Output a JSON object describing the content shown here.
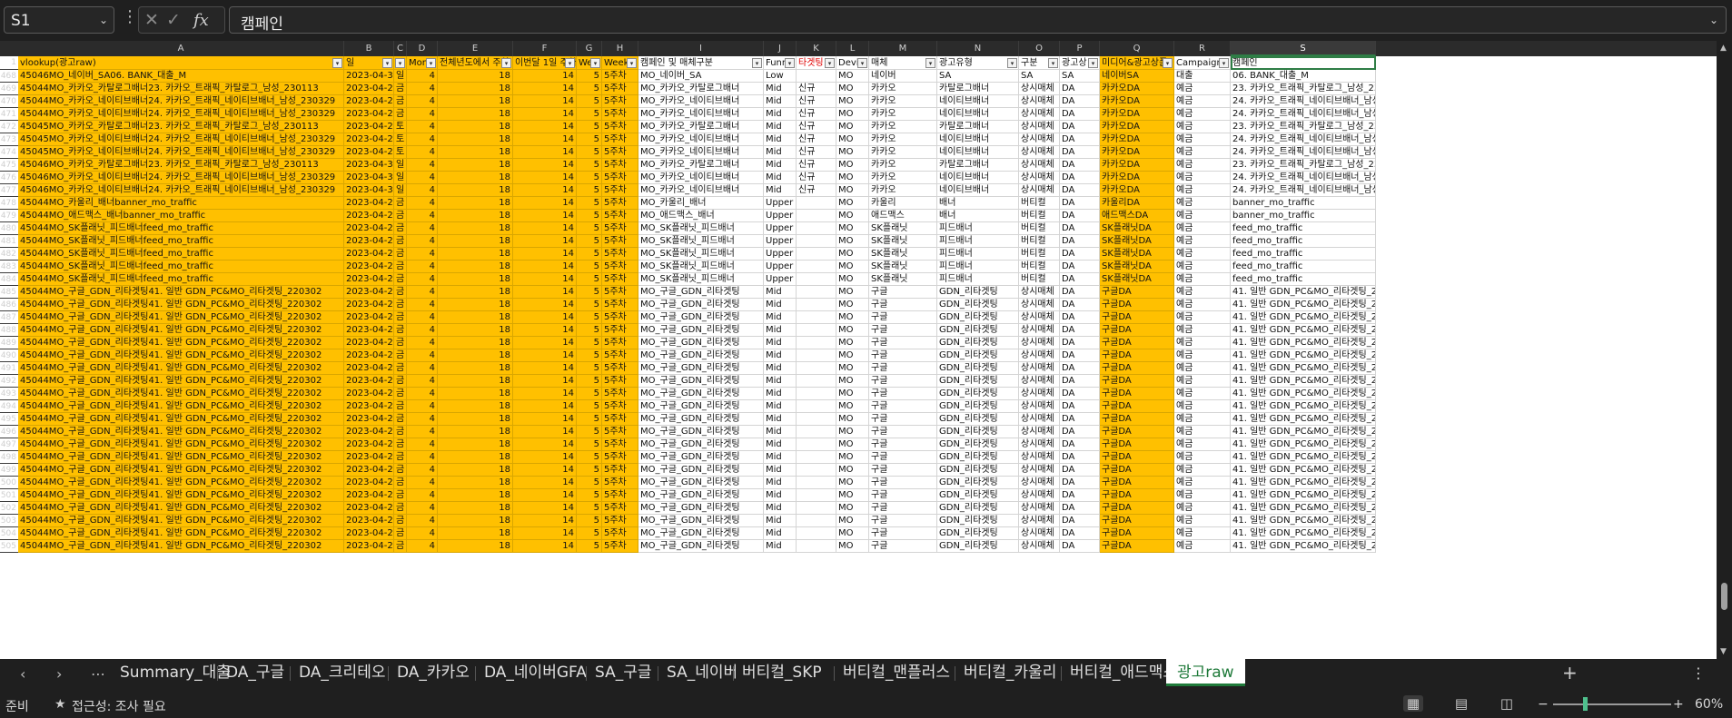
{
  "formula_bar": {
    "name_box": "S1",
    "formula": "캠페인",
    "cancel_icon": "x-icon",
    "enter_icon": "check-icon",
    "fx_label": "fx"
  },
  "columns": [
    "A",
    "B",
    "C",
    "D",
    "E",
    "F",
    "G",
    "H",
    "I",
    "J",
    "K",
    "L",
    "M",
    "N",
    "O",
    "P",
    "Q",
    "R",
    "S"
  ],
  "active_column": "S",
  "header_row": {
    "number": "1",
    "labels": [
      "vlookup(광고raw)",
      "일",
      "요",
      "Mon",
      "전체년도에서 주차",
      "이번달 1일 주차",
      "We",
      "Week",
      "캠페인 및 매체구분",
      "Funn",
      "타겟팅",
      "Devi",
      "매체",
      "광고유형",
      "구분",
      "광고상",
      "미디어&광고상품",
      "Campaign",
      "캠페인"
    ]
  },
  "rows": [
    {
      "n": "468",
      "c": [
        "45046MO_네이버_SA06. BANK_대출_M",
        "2023-04-30",
        "일",
        "4",
        "18",
        "14",
        "5",
        "5주차",
        "MO_네이버_SA",
        "Low",
        "",
        "MO",
        "네이버",
        "SA",
        "SA",
        "SA",
        "네이버SA",
        "대출",
        "06. BANK_대출_M"
      ]
    },
    {
      "n": "469",
      "c": [
        "45044MO_카카오_카탈로그배너23. 카카오_트래픽_카탈로그_남성_230113",
        "2023-04-28",
        "금",
        "4",
        "18",
        "14",
        "5",
        "5주차",
        "MO_카카오_카탈로그배너",
        "Mid",
        "신규",
        "MO",
        "카카오",
        "카탈로그배너",
        "상시매체",
        "DA",
        "카카오DA",
        "예금",
        "23. 카카오_트래픽_카탈로그_남성_2301"
      ]
    },
    {
      "n": "470",
      "c": [
        "45044MO_카카오_네이티브배너24. 카카오_트래픽_네이티브배너_남성_230329",
        "2023-04-28",
        "금",
        "4",
        "18",
        "14",
        "5",
        "5주차",
        "MO_카카오_네이티브배너",
        "Mid",
        "신규",
        "MO",
        "카카오",
        "네이티브배너",
        "상시매체",
        "DA",
        "카카오DA",
        "예금",
        "24. 카카오_트래픽_네이티브배너_남성_2"
      ]
    },
    {
      "n": "471",
      "c": [
        "45044MO_카카오_네이티브배너24. 카카오_트래픽_네이티브배너_남성_230329",
        "2023-04-28",
        "금",
        "4",
        "18",
        "14",
        "5",
        "5주차",
        "MO_카카오_네이티브배너",
        "Mid",
        "신규",
        "MO",
        "카카오",
        "네이티브배너",
        "상시매체",
        "DA",
        "카카오DA",
        "예금",
        "24. 카카오_트래픽_네이티브배너_남성_2"
      ]
    },
    {
      "n": "472",
      "c": [
        "45045MO_카카오_카탈로그배너23. 카카오_트래픽_카탈로그_남성_230113",
        "2023-04-29",
        "토",
        "4",
        "18",
        "14",
        "5",
        "5주차",
        "MO_카카오_카탈로그배너",
        "Mid",
        "신규",
        "MO",
        "카카오",
        "카탈로그배너",
        "상시매체",
        "DA",
        "카카오DA",
        "예금",
        "23. 카카오_트래픽_카탈로그_남성_2301"
      ]
    },
    {
      "n": "473",
      "c": [
        "45045MO_카카오_네이티브배너24. 카카오_트래픽_네이티브배너_남성_230329",
        "2023-04-29",
        "토",
        "4",
        "18",
        "14",
        "5",
        "5주차",
        "MO_카카오_네이티브배너",
        "Mid",
        "신규",
        "MO",
        "카카오",
        "네이티브배너",
        "상시매체",
        "DA",
        "카카오DA",
        "예금",
        "24. 카카오_트래픽_네이티브배너_남성_2"
      ]
    },
    {
      "n": "474",
      "c": [
        "45045MO_카카오_네이티브배너24. 카카오_트래픽_네이티브배너_남성_230329",
        "2023-04-29",
        "토",
        "4",
        "18",
        "14",
        "5",
        "5주차",
        "MO_카카오_네이티브배너",
        "Mid",
        "신규",
        "MO",
        "카카오",
        "네이티브배너",
        "상시매체",
        "DA",
        "카카오DA",
        "예금",
        "24. 카카오_트래픽_네이티브배너_남성_2"
      ]
    },
    {
      "n": "475",
      "c": [
        "45046MO_카카오_카탈로그배너23. 카카오_트래픽_카탈로그_남성_230113",
        "2023-04-30",
        "일",
        "4",
        "18",
        "14",
        "5",
        "5주차",
        "MO_카카오_카탈로그배너",
        "Mid",
        "신규",
        "MO",
        "카카오",
        "카탈로그배너",
        "상시매체",
        "DA",
        "카카오DA",
        "예금",
        "23. 카카오_트래픽_카탈로그_남성_2301"
      ]
    },
    {
      "n": "476",
      "c": [
        "45046MO_카카오_네이티브배너24. 카카오_트래픽_네이티브배너_남성_230329",
        "2023-04-30",
        "일",
        "4",
        "18",
        "14",
        "5",
        "5주차",
        "MO_카카오_네이티브배너",
        "Mid",
        "신규",
        "MO",
        "카카오",
        "네이티브배너",
        "상시매체",
        "DA",
        "카카오DA",
        "예금",
        "24. 카카오_트래픽_네이티브배너_남성_2"
      ]
    },
    {
      "n": "477",
      "c": [
        "45046MO_카카오_네이티브배너24. 카카오_트래픽_네이티브배너_남성_230329",
        "2023-04-30",
        "일",
        "4",
        "18",
        "14",
        "5",
        "5주차",
        "MO_카카오_네이티브배너",
        "Mid",
        "신규",
        "MO",
        "카카오",
        "네이티브배너",
        "상시매체",
        "DA",
        "카카오DA",
        "예금",
        "24. 카카오_트래픽_네이티브배너_남성_2"
      ]
    },
    {
      "n": "478",
      "c": [
        "45044MO_카울리_배너banner_mo_traffic",
        "2023-04-28",
        "금",
        "4",
        "18",
        "14",
        "5",
        "5주차",
        "MO_카울리_배너",
        "Upper",
        "",
        "MO",
        "카울리",
        "배너",
        "버티컬",
        "DA",
        "카울리DA",
        "예금",
        "banner_mo_traffic"
      ]
    },
    {
      "n": "479",
      "c": [
        "45044MO_애드맥스_배너banner_mo_traffic",
        "2023-04-28",
        "금",
        "4",
        "18",
        "14",
        "5",
        "5주차",
        "MO_애드맥스_배너",
        "Upper",
        "",
        "MO",
        "애드맥스",
        "배너",
        "버티컬",
        "DA",
        "애드맥스DA",
        "예금",
        "banner_mo_traffic"
      ]
    },
    {
      "n": "480",
      "c": [
        "45044MO_SK플래닛_피드배너feed_mo_traffic",
        "2023-04-28",
        "금",
        "4",
        "18",
        "14",
        "5",
        "5주차",
        "MO_SK플래닛_피드배너",
        "Upper",
        "",
        "MO",
        "SK플래닛",
        "피드배너",
        "버티컬",
        "DA",
        "SK플래닛DA",
        "예금",
        "feed_mo_traffic"
      ]
    },
    {
      "n": "481",
      "c": [
        "45044MO_SK플래닛_피드배너feed_mo_traffic",
        "2023-04-28",
        "금",
        "4",
        "18",
        "14",
        "5",
        "5주차",
        "MO_SK플래닛_피드배너",
        "Upper",
        "",
        "MO",
        "SK플래닛",
        "피드배너",
        "버티컬",
        "DA",
        "SK플래닛DA",
        "예금",
        "feed_mo_traffic"
      ]
    },
    {
      "n": "482",
      "c": [
        "45044MO_SK플래닛_피드배너feed_mo_traffic",
        "2023-04-28",
        "금",
        "4",
        "18",
        "14",
        "5",
        "5주차",
        "MO_SK플래닛_피드배너",
        "Upper",
        "",
        "MO",
        "SK플래닛",
        "피드배너",
        "버티컬",
        "DA",
        "SK플래닛DA",
        "예금",
        "feed_mo_traffic"
      ]
    },
    {
      "n": "483",
      "c": [
        "45044MO_SK플래닛_피드배너feed_mo_traffic",
        "2023-04-28",
        "금",
        "4",
        "18",
        "14",
        "5",
        "5주차",
        "MO_SK플래닛_피드배너",
        "Upper",
        "",
        "MO",
        "SK플래닛",
        "피드배너",
        "버티컬",
        "DA",
        "SK플래닛DA",
        "예금",
        "feed_mo_traffic"
      ]
    },
    {
      "n": "484",
      "c": [
        "45044MO_SK플래닛_피드배너feed_mo_traffic",
        "2023-04-28",
        "금",
        "4",
        "18",
        "14",
        "5",
        "5주차",
        "MO_SK플래닛_피드배너",
        "Upper",
        "",
        "MO",
        "SK플래닛",
        "피드배너",
        "버티컬",
        "DA",
        "SK플래닛DA",
        "예금",
        "feed_mo_traffic"
      ]
    },
    {
      "n": "485",
      "c": [
        "45044MO_구글_GDN_리타겟팅41. 일반 GDN_PC&MO_리타겟팅_220302",
        "2023-04-28",
        "금",
        "4",
        "18",
        "14",
        "5",
        "5주차",
        "MO_구글_GDN_리타겟팅",
        "Mid",
        "",
        "MO",
        "구글",
        "GDN_리타겟팅",
        "상시매체",
        "DA",
        "구글DA",
        "예금",
        "41. 일반 GDN_PC&MO_리타겟팅_22030"
      ]
    },
    {
      "n": "486",
      "c": [
        "45044MO_구글_GDN_리타겟팅41. 일반 GDN_PC&MO_리타겟팅_220302",
        "2023-04-28",
        "금",
        "4",
        "18",
        "14",
        "5",
        "5주차",
        "MO_구글_GDN_리타겟팅",
        "Mid",
        "",
        "MO",
        "구글",
        "GDN_리타겟팅",
        "상시매체",
        "DA",
        "구글DA",
        "예금",
        "41. 일반 GDN_PC&MO_리타겟팅_22030"
      ]
    },
    {
      "n": "487",
      "c": [
        "45044MO_구글_GDN_리타겟팅41. 일반 GDN_PC&MO_리타겟팅_220302",
        "2023-04-28",
        "금",
        "4",
        "18",
        "14",
        "5",
        "5주차",
        "MO_구글_GDN_리타겟팅",
        "Mid",
        "",
        "MO",
        "구글",
        "GDN_리타겟팅",
        "상시매체",
        "DA",
        "구글DA",
        "예금",
        "41. 일반 GDN_PC&MO_리타겟팅_22030"
      ]
    },
    {
      "n": "488",
      "c": [
        "45044MO_구글_GDN_리타겟팅41. 일반 GDN_PC&MO_리타겟팅_220302",
        "2023-04-28",
        "금",
        "4",
        "18",
        "14",
        "5",
        "5주차",
        "MO_구글_GDN_리타겟팅",
        "Mid",
        "",
        "MO",
        "구글",
        "GDN_리타겟팅",
        "상시매체",
        "DA",
        "구글DA",
        "예금",
        "41. 일반 GDN_PC&MO_리타겟팅_22030"
      ]
    },
    {
      "n": "489",
      "c": [
        "45044MO_구글_GDN_리타겟팅41. 일반 GDN_PC&MO_리타겟팅_220302",
        "2023-04-28",
        "금",
        "4",
        "18",
        "14",
        "5",
        "5주차",
        "MO_구글_GDN_리타겟팅",
        "Mid",
        "",
        "MO",
        "구글",
        "GDN_리타겟팅",
        "상시매체",
        "DA",
        "구글DA",
        "예금",
        "41. 일반 GDN_PC&MO_리타겟팅_22030"
      ]
    },
    {
      "n": "490",
      "c": [
        "45044MO_구글_GDN_리타겟팅41. 일반 GDN_PC&MO_리타겟팅_220302",
        "2023-04-28",
        "금",
        "4",
        "18",
        "14",
        "5",
        "5주차",
        "MO_구글_GDN_리타겟팅",
        "Mid",
        "",
        "MO",
        "구글",
        "GDN_리타겟팅",
        "상시매체",
        "DA",
        "구글DA",
        "예금",
        "41. 일반 GDN_PC&MO_리타겟팅_22030"
      ]
    },
    {
      "n": "491",
      "c": [
        "45044MO_구글_GDN_리타겟팅41. 일반 GDN_PC&MO_리타겟팅_220302",
        "2023-04-28",
        "금",
        "4",
        "18",
        "14",
        "5",
        "5주차",
        "MO_구글_GDN_리타겟팅",
        "Mid",
        "",
        "MO",
        "구글",
        "GDN_리타겟팅",
        "상시매체",
        "DA",
        "구글DA",
        "예금",
        "41. 일반 GDN_PC&MO_리타겟팅_22030"
      ]
    },
    {
      "n": "492",
      "c": [
        "45044MO_구글_GDN_리타겟팅41. 일반 GDN_PC&MO_리타겟팅_220302",
        "2023-04-28",
        "금",
        "4",
        "18",
        "14",
        "5",
        "5주차",
        "MO_구글_GDN_리타겟팅",
        "Mid",
        "",
        "MO",
        "구글",
        "GDN_리타겟팅",
        "상시매체",
        "DA",
        "구글DA",
        "예금",
        "41. 일반 GDN_PC&MO_리타겟팅_22030"
      ]
    },
    {
      "n": "493",
      "c": [
        "45044MO_구글_GDN_리타겟팅41. 일반 GDN_PC&MO_리타겟팅_220302",
        "2023-04-28",
        "금",
        "4",
        "18",
        "14",
        "5",
        "5주차",
        "MO_구글_GDN_리타겟팅",
        "Mid",
        "",
        "MO",
        "구글",
        "GDN_리타겟팅",
        "상시매체",
        "DA",
        "구글DA",
        "예금",
        "41. 일반 GDN_PC&MO_리타겟팅_22030"
      ]
    },
    {
      "n": "494",
      "c": [
        "45044MO_구글_GDN_리타겟팅41. 일반 GDN_PC&MO_리타겟팅_220302",
        "2023-04-28",
        "금",
        "4",
        "18",
        "14",
        "5",
        "5주차",
        "MO_구글_GDN_리타겟팅",
        "Mid",
        "",
        "MO",
        "구글",
        "GDN_리타겟팅",
        "상시매체",
        "DA",
        "구글DA",
        "예금",
        "41. 일반 GDN_PC&MO_리타겟팅_22030"
      ]
    },
    {
      "n": "495",
      "c": [
        "45044MO_구글_GDN_리타겟팅41. 일반 GDN_PC&MO_리타겟팅_220302",
        "2023-04-28",
        "금",
        "4",
        "18",
        "14",
        "5",
        "5주차",
        "MO_구글_GDN_리타겟팅",
        "Mid",
        "",
        "MO",
        "구글",
        "GDN_리타겟팅",
        "상시매체",
        "DA",
        "구글DA",
        "예금",
        "41. 일반 GDN_PC&MO_리타겟팅_22030"
      ]
    },
    {
      "n": "496",
      "c": [
        "45044MO_구글_GDN_리타겟팅41. 일반 GDN_PC&MO_리타겟팅_220302",
        "2023-04-28",
        "금",
        "4",
        "18",
        "14",
        "5",
        "5주차",
        "MO_구글_GDN_리타겟팅",
        "Mid",
        "",
        "MO",
        "구글",
        "GDN_리타겟팅",
        "상시매체",
        "DA",
        "구글DA",
        "예금",
        "41. 일반 GDN_PC&MO_리타겟팅_22030"
      ]
    },
    {
      "n": "497",
      "c": [
        "45044MO_구글_GDN_리타겟팅41. 일반 GDN_PC&MO_리타겟팅_220302",
        "2023-04-28",
        "금",
        "4",
        "18",
        "14",
        "5",
        "5주차",
        "MO_구글_GDN_리타겟팅",
        "Mid",
        "",
        "MO",
        "구글",
        "GDN_리타겟팅",
        "상시매체",
        "DA",
        "구글DA",
        "예금",
        "41. 일반 GDN_PC&MO_리타겟팅_22030"
      ]
    },
    {
      "n": "498",
      "c": [
        "45044MO_구글_GDN_리타겟팅41. 일반 GDN_PC&MO_리타겟팅_220302",
        "2023-04-28",
        "금",
        "4",
        "18",
        "14",
        "5",
        "5주차",
        "MO_구글_GDN_리타겟팅",
        "Mid",
        "",
        "MO",
        "구글",
        "GDN_리타겟팅",
        "상시매체",
        "DA",
        "구글DA",
        "예금",
        "41. 일반 GDN_PC&MO_리타겟팅_22030"
      ]
    },
    {
      "n": "499",
      "c": [
        "45044MO_구글_GDN_리타겟팅41. 일반 GDN_PC&MO_리타겟팅_220302",
        "2023-04-28",
        "금",
        "4",
        "18",
        "14",
        "5",
        "5주차",
        "MO_구글_GDN_리타겟팅",
        "Mid",
        "",
        "MO",
        "구글",
        "GDN_리타겟팅",
        "상시매체",
        "DA",
        "구글DA",
        "예금",
        "41. 일반 GDN_PC&MO_리타겟팅_22030"
      ]
    },
    {
      "n": "500",
      "c": [
        "45044MO_구글_GDN_리타겟팅41. 일반 GDN_PC&MO_리타겟팅_220302",
        "2023-04-28",
        "금",
        "4",
        "18",
        "14",
        "5",
        "5주차",
        "MO_구글_GDN_리타겟팅",
        "Mid",
        "",
        "MO",
        "구글",
        "GDN_리타겟팅",
        "상시매체",
        "DA",
        "구글DA",
        "예금",
        "41. 일반 GDN_PC&MO_리타겟팅_22030"
      ]
    },
    {
      "n": "501",
      "c": [
        "45044MO_구글_GDN_리타겟팅41. 일반 GDN_PC&MO_리타겟팅_220302",
        "2023-04-28",
        "금",
        "4",
        "18",
        "14",
        "5",
        "5주차",
        "MO_구글_GDN_리타겟팅",
        "Mid",
        "",
        "MO",
        "구글",
        "GDN_리타겟팅",
        "상시매체",
        "DA",
        "구글DA",
        "예금",
        "41. 일반 GDN_PC&MO_리타겟팅_22030"
      ]
    },
    {
      "n": "502",
      "c": [
        "45044MO_구글_GDN_리타겟팅41. 일반 GDN_PC&MO_리타겟팅_220302",
        "2023-04-28",
        "금",
        "4",
        "18",
        "14",
        "5",
        "5주차",
        "MO_구글_GDN_리타겟팅",
        "Mid",
        "",
        "MO",
        "구글",
        "GDN_리타겟팅",
        "상시매체",
        "DA",
        "구글DA",
        "예금",
        "41. 일반 GDN_PC&MO_리타겟팅_22030"
      ]
    },
    {
      "n": "503",
      "c": [
        "45044MO_구글_GDN_리타겟팅41. 일반 GDN_PC&MO_리타겟팅_220302",
        "2023-04-28",
        "금",
        "4",
        "18",
        "14",
        "5",
        "5주차",
        "MO_구글_GDN_리타겟팅",
        "Mid",
        "",
        "MO",
        "구글",
        "GDN_리타겟팅",
        "상시매체",
        "DA",
        "구글DA",
        "예금",
        "41. 일반 GDN_PC&MO_리타겟팅_22030"
      ]
    },
    {
      "n": "504",
      "c": [
        "45044MO_구글_GDN_리타겟팅41. 일반 GDN_PC&MO_리타겟팅_220302",
        "2023-04-28",
        "금",
        "4",
        "18",
        "14",
        "5",
        "5주차",
        "MO_구글_GDN_리타겟팅",
        "Mid",
        "",
        "MO",
        "구글",
        "GDN_리타겟팅",
        "상시매체",
        "DA",
        "구글DA",
        "예금",
        "41. 일반 GDN_PC&MO_리타겟팅_22030"
      ]
    },
    {
      "n": "505",
      "c": [
        "45044MO_구글_GDN_리타겟팅41. 일반 GDN_PC&MO_리타겟팅_220302",
        "2023-04-28",
        "금",
        "4",
        "18",
        "14",
        "5",
        "5주차",
        "MO_구글_GDN_리타겟팅",
        "Mid",
        "",
        "MO",
        "구글",
        "GDN_리타겟팅",
        "상시매체",
        "DA",
        "구글DA",
        "예금",
        "41. 일반 GDN_PC&MO_리타겟팅_22030"
      ]
    }
  ],
  "sheet_tabs": [
    "Summary_대출",
    "DA_구글",
    "DA_크리테오",
    "DA_카카오",
    "DA_네이버GFA",
    "SA_구글",
    "SA_네이버",
    "버티컬_SKP",
    "버티컬_맨플러스",
    "버티컬_카울리",
    "버티컬_애드맥스",
    "광고raw"
  ],
  "active_sheet": "광고raw",
  "status_bar": {
    "ready": "준비",
    "accessibility": "접근성: 조사 필요",
    "zoom": "60%",
    "zoom_level_percent": 60
  },
  "colors": {
    "highlight": "#ffc000",
    "accent": "#1f7a3a",
    "red_header": "#e00000"
  }
}
